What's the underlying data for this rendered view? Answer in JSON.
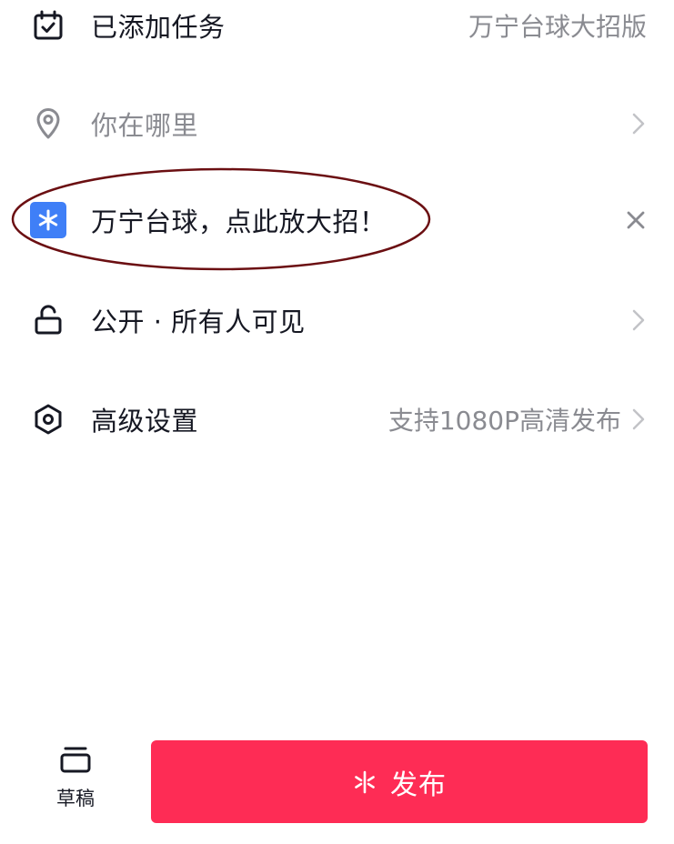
{
  "rows": {
    "task": {
      "label": "已添加任务",
      "value": "万宁台球大招版"
    },
    "location": {
      "label": "你在哪里"
    },
    "promo": {
      "label": "万宁台球，点此放大招！"
    },
    "privacy": {
      "label": "公开 · 所有人可见"
    },
    "advanced": {
      "label": "高级设置",
      "value": "支持1080P高清发布"
    }
  },
  "bottom": {
    "draft_label": "草稿",
    "publish_label": "发布"
  },
  "colors": {
    "accent": "#fe2c55",
    "badge": "#3f7ff7",
    "highlight": "#6b0f12",
    "text": "#161823",
    "muted": "#8a8b91"
  }
}
